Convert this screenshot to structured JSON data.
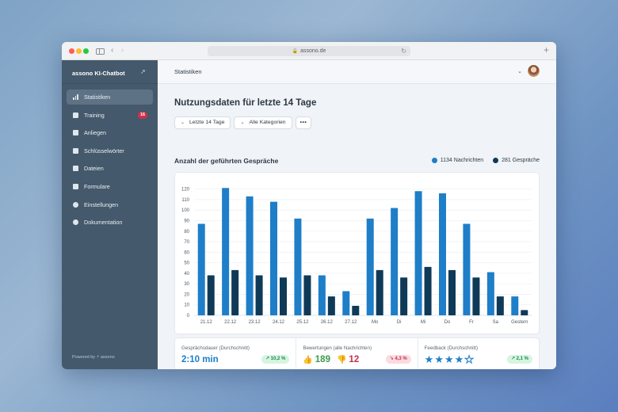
{
  "browser": {
    "url": "assono.de",
    "new_tab": "+"
  },
  "sidebar": {
    "brand": "assono KI-Chatbot",
    "items": [
      {
        "label": "Statistiken",
        "icon": "bar-chart-icon",
        "active": true
      },
      {
        "label": "Training",
        "icon": "chat-bubble-icon",
        "badge": "16"
      },
      {
        "label": "Anliegen",
        "icon": "database-icon"
      },
      {
        "label": "Schlüsselwörter",
        "icon": "book-icon"
      },
      {
        "label": "Dateien",
        "icon": "folder-icon"
      },
      {
        "label": "Formulare",
        "icon": "form-icon"
      },
      {
        "label": "Einstellungen",
        "icon": "gear-icon"
      },
      {
        "label": "Dokumentation",
        "icon": "question-icon"
      }
    ],
    "powered_by": "Powered by ⚡ assono"
  },
  "header": {
    "title": "Statistiken"
  },
  "page": {
    "title": "Nutzungsdaten für letzte 14 Tage",
    "filters": {
      "period": "Letzte 14 Tage",
      "category": "Alle Kategorien",
      "more": "•••"
    }
  },
  "chart": {
    "title": "Anzahl der geführten Gespräche",
    "legend_messages": "1134 Nachrichten",
    "legend_conversations": "281 Gespräche"
  },
  "chart_data": {
    "type": "bar",
    "title": "Anzahl der geführten Gespräche",
    "categories": [
      "21.12",
      "22.12",
      "23.12",
      "24.12",
      "25.12",
      "26.12",
      "27.12",
      "Mo",
      "Di",
      "Mi",
      "Do",
      "Fr",
      "Sa",
      "Gestern"
    ],
    "series": [
      {
        "name": "1134 Nachrichten",
        "color": "#1e7ec8",
        "values": [
          87,
          121,
          113,
          108,
          92,
          38,
          23,
          92,
          102,
          118,
          116,
          87,
          41,
          18
        ]
      },
      {
        "name": "281 Gespräche",
        "color": "#0f3a57",
        "values": [
          38,
          43,
          38,
          36,
          38,
          18,
          9,
          43,
          36,
          46,
          43,
          36,
          18,
          5
        ]
      }
    ],
    "yticks": [
      0,
      10,
      20,
      30,
      40,
      50,
      60,
      70,
      80,
      90,
      100,
      110,
      120
    ],
    "ylim": [
      0,
      125
    ],
    "grid": true,
    "legend_position": "top-right"
  },
  "stats": {
    "duration": {
      "label": "Gesprächsdauer (Durchschnitt)",
      "value": "2:10 min",
      "trend": "10,2 %"
    },
    "ratings": {
      "label": "Bewertungen (alle Nachrichten)",
      "up": "189",
      "down": "12",
      "trend": "4,3 %"
    },
    "feedback": {
      "label": "Feedback (Durchschnitt)",
      "rating": 4,
      "max": 5,
      "trend": "2,1 %"
    }
  }
}
